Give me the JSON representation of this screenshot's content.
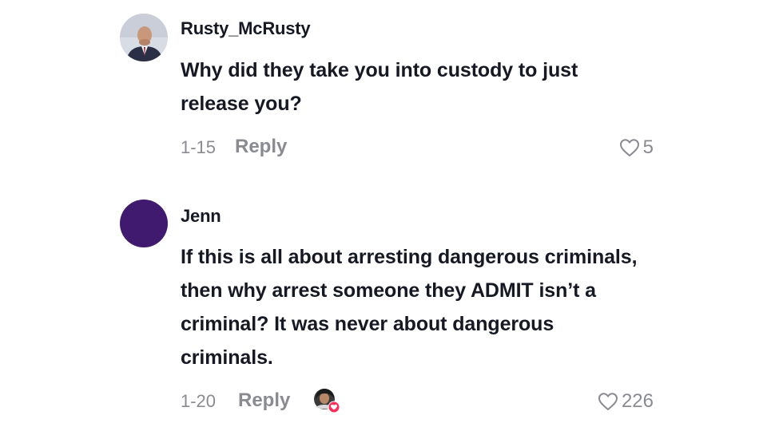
{
  "comments": [
    {
      "username": "Rusty_McRusty",
      "text": "Why did they take you into custody to just release you?",
      "date": "1-15",
      "reply_label": "Reply",
      "likes": "5",
      "avatar": "profile-photo-man-in-suit"
    },
    {
      "username": "Jenn",
      "text": "If this is all about arresting dangerous criminals, then why arrest someone they ADMIT isn’t a criminal? It was never about dangerous criminals.",
      "date": "1-20",
      "reply_label": "Reply",
      "likes": "226",
      "avatar": "plain-purple-circle",
      "creator_liked": true
    }
  ],
  "colors": {
    "text_primary": "#161823",
    "text_secondary": "#8a8b91",
    "avatar_purple": "#3f1a6e",
    "heart_badge": "#fe2c55"
  },
  "icons": {
    "like": "heart-outline-icon",
    "creator_liked_badge": "heart-badge-icon"
  }
}
